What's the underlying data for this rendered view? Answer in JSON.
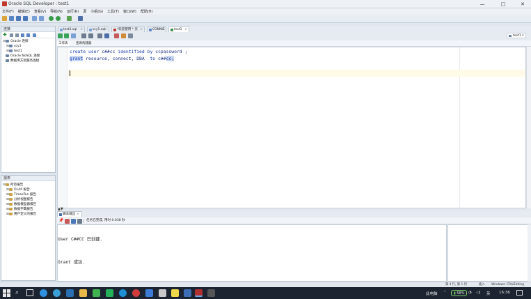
{
  "window": {
    "title": "Oracle SQL Developer : test1"
  },
  "menu": [
    "文件(F)",
    "编辑(E)",
    "查看(V)",
    "导航(N)",
    "运行(R)",
    "源",
    "小组(G)",
    "工具(T)",
    "窗口(W)",
    "帮助(H)"
  ],
  "connections_panel": {
    "title": "连接",
    "items": [
      {
        "label": "Oracle 连接",
        "level": 0,
        "expander": "⊟"
      },
      {
        "label": "scy1",
        "level": 1,
        "expander": "⊞"
      },
      {
        "label": "test1",
        "level": 1,
        "expander": "⊞"
      },
      {
        "label": "Oracle NoSQL 连接",
        "level": 0,
        "expander": ""
      },
      {
        "label": "数据库方案服务连接",
        "level": 0,
        "expander": ""
      }
    ]
  },
  "reports_panel": {
    "title": "报表",
    "items": [
      {
        "label": "所有报告",
        "level": 0,
        "expander": "⊟"
      },
      {
        "label": "OLAP 报告",
        "level": 1,
        "expander": "⊞"
      },
      {
        "label": "TimesTen 报告",
        "level": 1,
        "expander": "⊞"
      },
      {
        "label": "分析视图报告",
        "level": 1,
        "expander": "⊞"
      },
      {
        "label": "数据模型器报告",
        "level": 1,
        "expander": "⊞"
      },
      {
        "label": "数据字典报告",
        "level": 1,
        "expander": "⊞"
      },
      {
        "label": "用户定义的报告",
        "level": 1,
        "expander": "⊞"
      }
    ]
  },
  "editor_tabs": [
    {
      "label": "test1.sql",
      "active": false
    },
    {
      "label": "scy1.sql",
      "active": false
    },
    {
      "label": "*欢迎使用 * 页",
      "active": false
    },
    {
      "label": "CONNIE",
      "active": false
    },
    {
      "label": "test1",
      "active": true
    }
  ],
  "connection_selector": "test1",
  "sub_tabs": [
    "工作表",
    "查询构建器"
  ],
  "code_lines": [
    {
      "parts": [
        [
          "kw",
          "create"
        ],
        [
          "p",
          " "
        ],
        [
          "kw",
          "user"
        ],
        [
          "p",
          " c##cc "
        ],
        [
          "kw",
          "identified"
        ],
        [
          "p",
          " "
        ],
        [
          "kw",
          "by"
        ],
        [
          "p",
          " ccpassword ;"
        ]
      ]
    },
    {
      "parts": [
        [
          "selkw",
          "grant"
        ],
        [
          "p",
          " resource, connect, DBA  "
        ],
        [
          "kw",
          "to"
        ],
        [
          "p",
          " c##"
        ],
        [
          "sel",
          "cc;"
        ]
      ]
    }
  ],
  "output_panel": {
    "tab_label": "脚本输出",
    "status": "任务已完成, 用时 0.038 秒",
    "lines": [
      "User C##CC 已创建.",
      "Grant 成功."
    ]
  },
  "statusbar": {
    "position": "第 4 行, 第 1 列",
    "mode": "插入",
    "line_ending": "Windows: CR/LF",
    "edit_mode": "Editing"
  },
  "taskbar": {
    "tray_label": "此电脑",
    "battery": "58%",
    "lang": "英",
    "time": "16:36"
  },
  "colors": {
    "accent": "#1a3db0",
    "current_line": "#fffbe6",
    "taskbar": "#1b2430"
  }
}
